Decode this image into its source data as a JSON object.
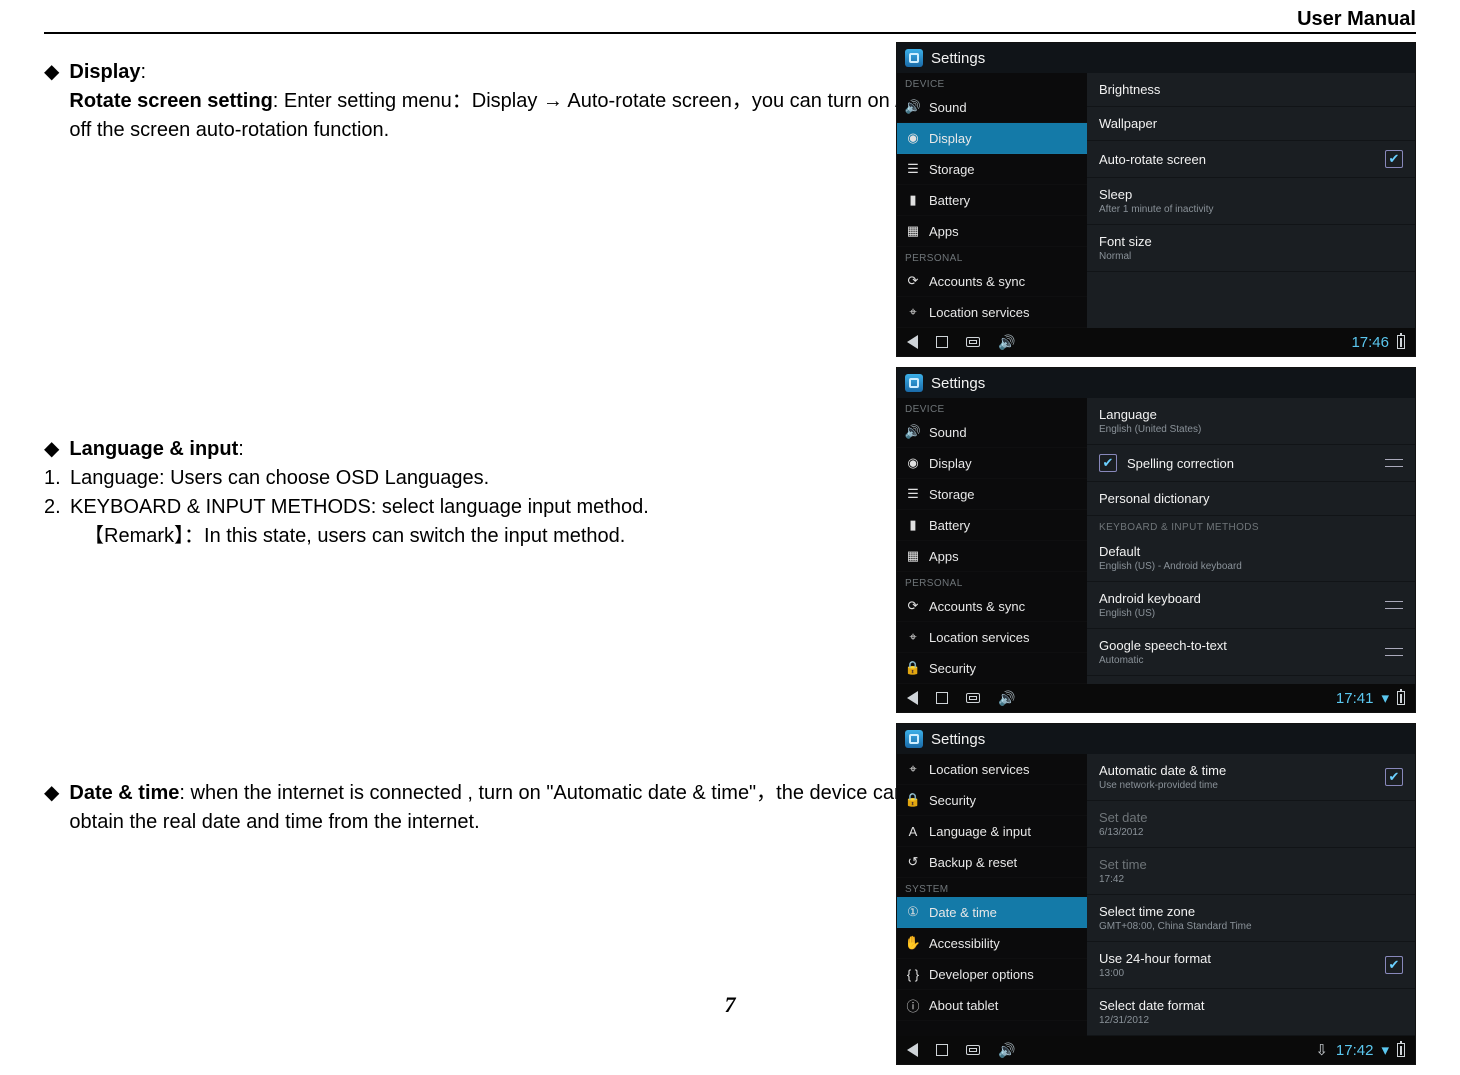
{
  "header": {
    "label": "User Manual"
  },
  "page_number": "7",
  "body": {
    "display": {
      "title": "Display",
      "colon": ":",
      "rotate_label": "Rotate screen setting",
      "rotate_text": ": Enter setting menu：Display → Auto-rotate screen，you can turn on / off the screen auto-rotation function."
    },
    "langinput": {
      "title": "Language & input",
      "colon": ":",
      "item1_num": "1.",
      "item1": "Language: Users can choose OSD Languages.",
      "item2_num": "2.",
      "item2": "KEYBOARD & INPUT METHODS: select language input method.",
      "remark": "【Remark】：In this state, users can switch the input method."
    },
    "datetime": {
      "title": "Date & time",
      "text": ": when the internet is connected , turn on \"Automatic date & time\"，the device can obtain the real date and time from the internet."
    }
  },
  "shot1": {
    "title": "Settings",
    "cat_device": "DEVICE",
    "cat_personal": "PERSONAL",
    "side": {
      "sound": "Sound",
      "display": "Display",
      "storage": "Storage",
      "battery": "Battery",
      "apps": "Apps",
      "accounts": "Accounts & sync",
      "location": "Location services"
    },
    "panel": {
      "brightness": "Brightness",
      "wallpaper": "Wallpaper",
      "autorotate": "Auto-rotate screen",
      "sleep": "Sleep",
      "sleep_sub": "After 1 minute of inactivity",
      "fontsize": "Font size",
      "fontsize_sub": "Normal"
    },
    "time": "17:46"
  },
  "shot2": {
    "title": "Settings",
    "cat_device": "DEVICE",
    "cat_personal": "PERSONAL",
    "cat_kbd": "KEYBOARD & INPUT METHODS",
    "side": {
      "sound": "Sound",
      "display": "Display",
      "storage": "Storage",
      "battery": "Battery",
      "apps": "Apps",
      "accounts": "Accounts & sync",
      "location": "Location services",
      "security": "Security"
    },
    "panel": {
      "language": "Language",
      "language_sub": "English (United States)",
      "spelling": "Spelling correction",
      "dictionary": "Personal dictionary",
      "default": "Default",
      "default_sub": "English (US) - Android keyboard",
      "akbd": "Android keyboard",
      "akbd_sub": "English (US)",
      "gstt": "Google speech-to-text",
      "gstt_sub": "Automatic"
    },
    "time": "17:41"
  },
  "shot3": {
    "title": "Settings",
    "cat_system": "SYSTEM",
    "side": {
      "location": "Location services",
      "security": "Security",
      "langinput": "Language & input",
      "backup": "Backup & reset",
      "datetime": "Date & time",
      "accessibility": "Accessibility",
      "devopts": "Developer options",
      "about": "About tablet"
    },
    "panel": {
      "auto": "Automatic date & time",
      "auto_sub": "Use network-provided time",
      "setdate": "Set date",
      "setdate_sub": "6/13/2012",
      "settime": "Set time",
      "settime_sub": "17:42",
      "tz": "Select time zone",
      "tz_sub": "GMT+08:00, China Standard Time",
      "use24": "Use 24-hour format",
      "use24_sub": "13:00",
      "datefmt": "Select date format",
      "datefmt_sub": "12/31/2012"
    },
    "time": "17:42"
  }
}
